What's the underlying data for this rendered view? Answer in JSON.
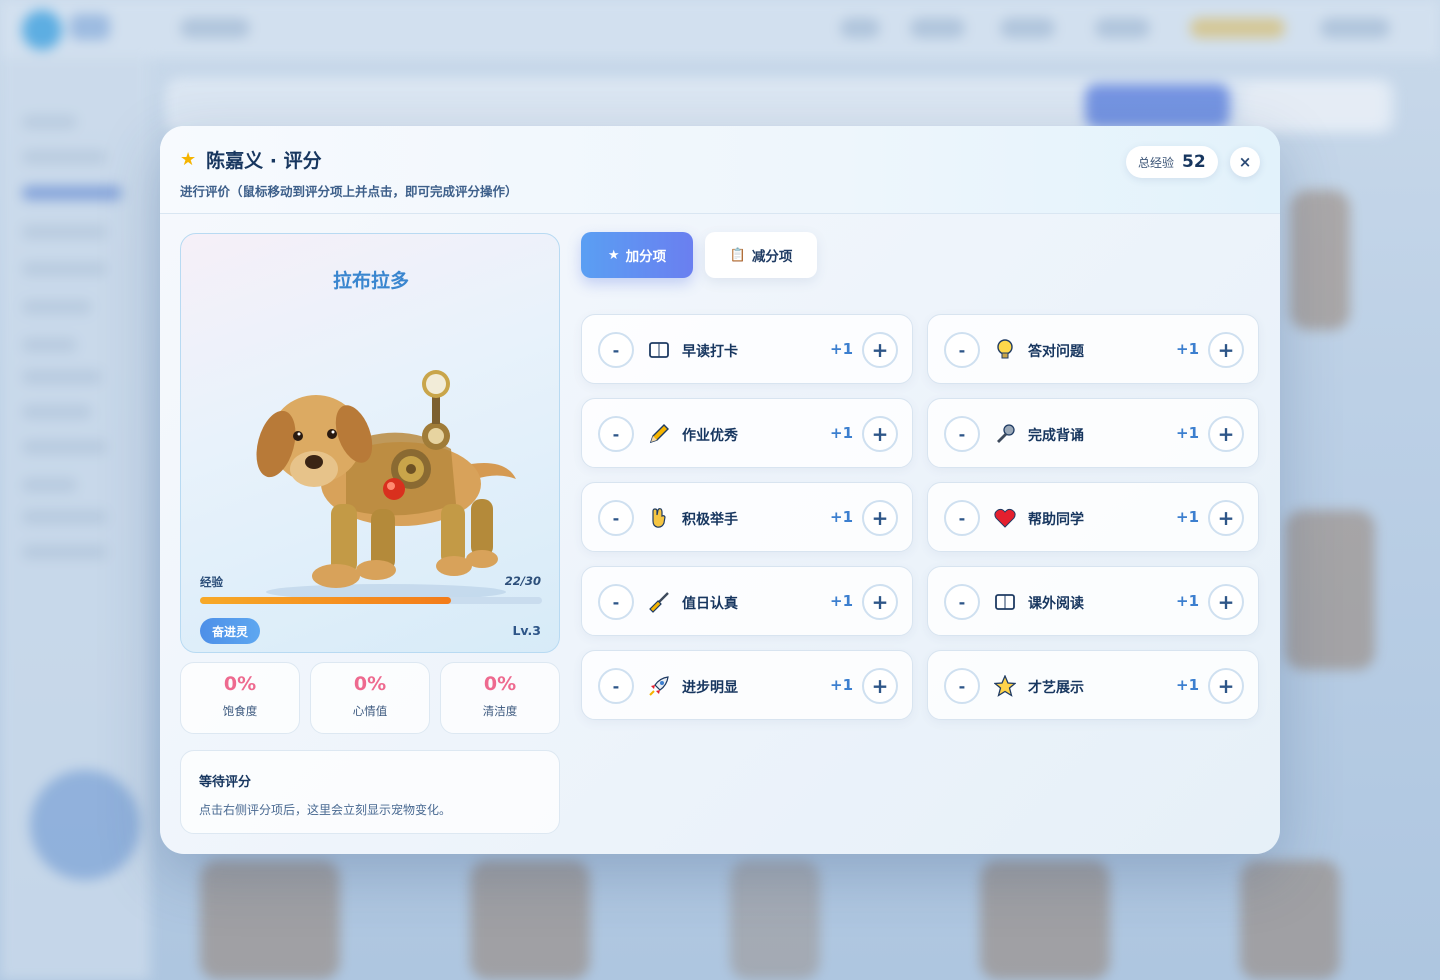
{
  "modal": {
    "title": "陈嘉义 · 评分",
    "subtitle": "进行评价（鼠标移动到评分项上并点击，即可完成评分操作）",
    "total_exp_label": "总经验",
    "total_exp_value": "52",
    "close_label": "×"
  },
  "pet": {
    "name": "拉布拉多",
    "exp_label": "经验",
    "exp_value": "22/30",
    "exp_progress": 0.733,
    "stage": "奋进灵",
    "level": "Lv.3"
  },
  "stats": [
    {
      "value": "0%",
      "label": "饱食度"
    },
    {
      "value": "0%",
      "label": "心情值"
    },
    {
      "value": "0%",
      "label": "清洁度"
    }
  ],
  "status": {
    "title": "等待评分",
    "description": "点击右侧评分项后，这里会立刻显示宠物变化。"
  },
  "tabs": {
    "add": {
      "icon": "★",
      "label": "加分项"
    },
    "minus": {
      "icon": "📋",
      "label": "减分项"
    }
  },
  "items": [
    {
      "label": "早读打卡",
      "score": "+1",
      "icon": "book-icon"
    },
    {
      "label": "答对问题",
      "score": "+1",
      "icon": "lightbulb-icon"
    },
    {
      "label": "作业优秀",
      "score": "+1",
      "icon": "pencil-icon"
    },
    {
      "label": "完成背诵",
      "score": "+1",
      "icon": "microphone-icon"
    },
    {
      "label": "积极举手",
      "score": "+1",
      "icon": "raised-hand-icon"
    },
    {
      "label": "帮助同学",
      "score": "+1",
      "icon": "heart-icon"
    },
    {
      "label": "值日认真",
      "score": "+1",
      "icon": "broom-icon"
    },
    {
      "label": "课外阅读",
      "score": "+1",
      "icon": "book-icon"
    },
    {
      "label": "进步明显",
      "score": "+1",
      "icon": "rocket-icon"
    },
    {
      "label": "才艺展示",
      "score": "+1",
      "icon": "star-icon"
    }
  ],
  "buttons": {
    "minus": "-",
    "plus": "+"
  }
}
